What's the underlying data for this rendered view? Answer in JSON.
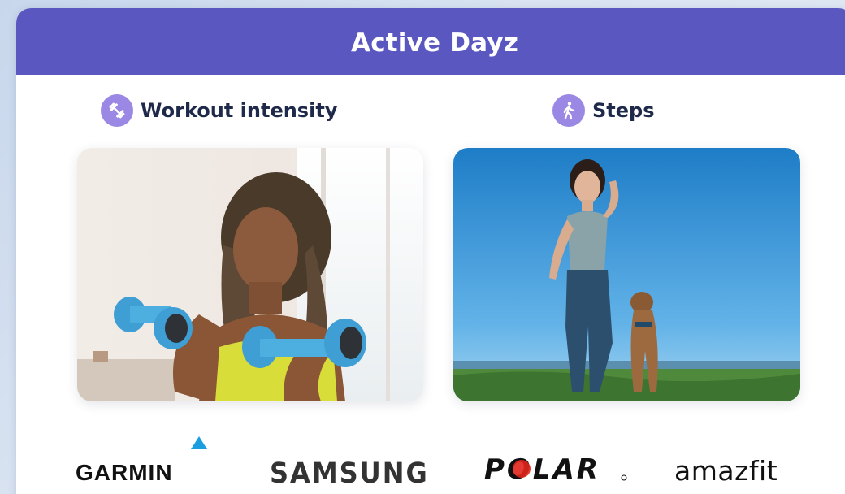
{
  "header": {
    "title": "Active Dayz"
  },
  "sections": {
    "workout": {
      "label": "Workout intensity",
      "icon": "dumbbell-icon"
    },
    "steps": {
      "label": "Steps",
      "icon": "walking-person-icon"
    }
  },
  "logos": {
    "garmin": "GARMIN",
    "samsung": "SAMSUNG",
    "polar": "POLAR",
    "amazfit": "amazfit"
  },
  "colors": {
    "header": "#5b57c0",
    "icon_badge": "#9b87e4",
    "heading_text": "#1f2a4a",
    "polar_red": "#e1251b",
    "garmin_blue": "#1a9ee0"
  }
}
